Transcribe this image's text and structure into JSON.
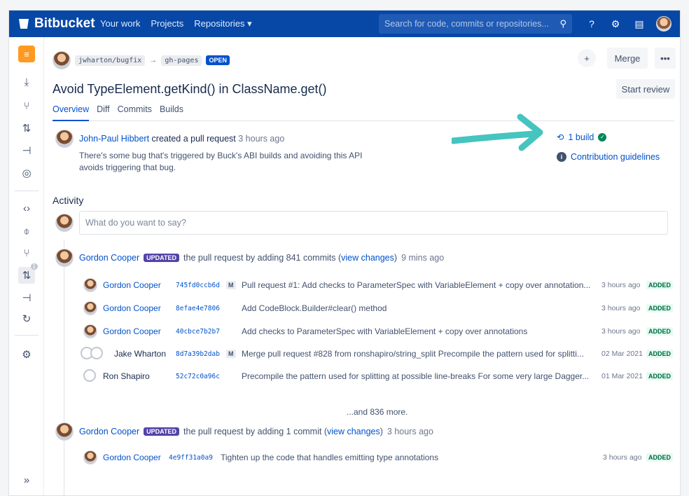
{
  "topbar": {
    "brand": "Bitbucket",
    "nav": [
      "Your work",
      "Projects",
      "Repositories ▾"
    ],
    "search_placeholder": "Search for code, commits or repositories...",
    "icons": [
      "search-icon",
      "help-icon",
      "settings-icon",
      "notifications-icon",
      "user-avatar"
    ]
  },
  "sidebar": {
    "items": [
      "repo-logo",
      "clone-icon",
      "branches-icon",
      "pull-requests-icon",
      "fork-icon",
      "compare-icon",
      "source-icon",
      "commits-icon",
      "branches-icon",
      "pull-requests-icon",
      "pipelines-icon",
      "deployments-icon",
      "settings-icon",
      "expand-icon"
    ],
    "pr_badge": "1",
    "expand_label": "»"
  },
  "pr": {
    "source_branch": "jwharton/bugfix",
    "arrow": "→",
    "target_branch": "gh-pages",
    "status": "OPEN",
    "title": "Avoid TypeElement.getKind() in ClassName.get()",
    "merge_label": "Merge",
    "more_label": "•••",
    "plus_label": "+",
    "start_review_label": "Start review",
    "tabs": [
      "Overview",
      "Diff",
      "Commits",
      "Builds"
    ],
    "author": "John-Paul Hibbert",
    "action": "created a pull request",
    "time": "3 hours ago",
    "description": "There's some bug that's triggered by Buck's ABI builds and avoiding this API avoids triggering that bug.",
    "build_label": "1 build",
    "guidelines_label": "Contribution guidelines"
  },
  "activity": {
    "heading": "Activity",
    "comment_placeholder": "What do you want to say?",
    "events": [
      {
        "author": "Gordon Cooper",
        "badge": "UPDATED",
        "text": "the pull request by adding 841 commits (",
        "link": "view changes",
        "text_end": ")",
        "time": "9 mins ago",
        "commits": [
          {
            "author": "Gordon Cooper",
            "hash": "745fd0ccb6d",
            "merge": "M",
            "message": "Pull request #1: Add checks to ParameterSpec with VariableElement + copy over annotation...",
            "time": "3 hours ago",
            "status": "ADDED"
          },
          {
            "author": "Gordon Cooper",
            "hash": "8efae4e7806",
            "merge": "",
            "message": "Add CodeBlock.Builder#clear() method",
            "time": "3 hours ago",
            "status": "ADDED"
          },
          {
            "author": "Gordon Cooper",
            "hash": "40cbce7b2b7",
            "merge": "",
            "message": "Add checks to ParameterSpec with VariableElement + copy over annotations",
            "time": "3 hours ago",
            "status": "ADDED"
          },
          {
            "author": "Jake Wharton",
            "hash": "8d7a39b2dab",
            "merge": "M",
            "message": "Merge pull request #828 from ronshapiro/string_split Precompile the pattern used for splitti...",
            "time": "02 Mar 2021",
            "status": "ADDED"
          },
          {
            "author": "Ron Shapiro",
            "hash": "52c72c0a96c",
            "merge": "",
            "message": "Precompile the pattern used for splitting at possible line-breaks For some very large Dagger...",
            "time": "01 Mar 2021",
            "status": "ADDED"
          }
        ],
        "more": "...and 836 more."
      },
      {
        "author": "Gordon Cooper",
        "badge": "UPDATED",
        "text": "the pull request by adding 1 commit (",
        "link": "view changes",
        "text_end": ")",
        "time": "3 hours ago",
        "commits": [
          {
            "author": "Gordon Cooper",
            "hash": "4e9ff31a0a9",
            "merge": "",
            "message": "Tighten up the code that handles emitting type annotations",
            "time": "3 hours ago",
            "status": "ADDED"
          }
        ]
      }
    ]
  }
}
